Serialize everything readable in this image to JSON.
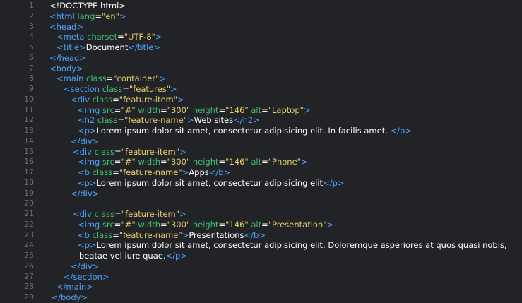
{
  "colors": {
    "background": "#212326",
    "line_number": "#6b6f75",
    "tag": "#4aa3ff",
    "attribute": "#40c070",
    "string": "#e7d06a",
    "text": "#ffffff"
  },
  "lines": [
    {
      "num": "1",
      "indent": 0,
      "tokens": [
        {
          "t": "txt",
          "v": "<!DOCTYPE html>"
        }
      ]
    },
    {
      "num": "2",
      "indent": 0,
      "tokens": [
        {
          "t": "tag",
          "v": "<html "
        },
        {
          "t": "attr",
          "v": "lang"
        },
        {
          "t": "txt",
          "v": "="
        },
        {
          "t": "str",
          "v": "\"en\""
        },
        {
          "t": "tag",
          "v": ">"
        }
      ]
    },
    {
      "num": "3",
      "indent": 0,
      "tokens": [
        {
          "t": "tag",
          "v": "<head>"
        }
      ]
    },
    {
      "num": "4",
      "indent": 1,
      "tokens": [
        {
          "t": "tag",
          "v": "<meta "
        },
        {
          "t": "attr",
          "v": "charset"
        },
        {
          "t": "txt",
          "v": "="
        },
        {
          "t": "str",
          "v": "\"UTF-8\""
        },
        {
          "t": "tag",
          "v": ">"
        }
      ]
    },
    {
      "num": "5",
      "indent": 1,
      "tokens": [
        {
          "t": "tag",
          "v": "<title>"
        },
        {
          "t": "txt",
          "v": "Document"
        },
        {
          "t": "tag",
          "v": "</title>"
        }
      ]
    },
    {
      "num": "6",
      "indent": 0,
      "tokens": [
        {
          "t": "tag",
          "v": "</head>"
        }
      ]
    },
    {
      "num": "7",
      "indent": 0,
      "tokens": [
        {
          "t": "tag",
          "v": "<body>"
        }
      ]
    },
    {
      "num": "8",
      "indent": 1,
      "tokens": [
        {
          "t": "tag",
          "v": "<main "
        },
        {
          "t": "attr",
          "v": "class"
        },
        {
          "t": "txt",
          "v": "="
        },
        {
          "t": "str",
          "v": "\"container\""
        },
        {
          "t": "tag",
          "v": ">"
        }
      ]
    },
    {
      "num": "9",
      "indent": 2,
      "tokens": [
        {
          "t": "tag",
          "v": "<section "
        },
        {
          "t": "attr",
          "v": "class"
        },
        {
          "t": "txt",
          "v": "="
        },
        {
          "t": "str",
          "v": "\"features\""
        },
        {
          "t": "tag",
          "v": ">"
        }
      ]
    },
    {
      "num": "10",
      "indent": 3,
      "tokens": [
        {
          "t": "tag",
          "v": "<div "
        },
        {
          "t": "attr",
          "v": "class"
        },
        {
          "t": "txt",
          "v": "="
        },
        {
          "t": "str",
          "v": "\"feature-item\""
        },
        {
          "t": "tag",
          "v": ">"
        }
      ]
    },
    {
      "num": "11",
      "indent": 4,
      "tokens": [
        {
          "t": "tag",
          "v": "<img "
        },
        {
          "t": "attr",
          "v": "src"
        },
        {
          "t": "txt",
          "v": "="
        },
        {
          "t": "str",
          "v": "\"#\" "
        },
        {
          "t": "attr",
          "v": "width"
        },
        {
          "t": "txt",
          "v": "="
        },
        {
          "t": "str",
          "v": "\"300\" "
        },
        {
          "t": "attr",
          "v": "height"
        },
        {
          "t": "txt",
          "v": "="
        },
        {
          "t": "str",
          "v": "\"146\" "
        },
        {
          "t": "attr",
          "v": "alt"
        },
        {
          "t": "txt",
          "v": "="
        },
        {
          "t": "str",
          "v": "\"Laptop\""
        },
        {
          "t": "tag",
          "v": ">"
        }
      ]
    },
    {
      "num": "12",
      "indent": 4,
      "tokens": [
        {
          "t": "tag",
          "v": "<h2 "
        },
        {
          "t": "attr",
          "v": "class"
        },
        {
          "t": "txt",
          "v": "="
        },
        {
          "t": "str",
          "v": "\"feature-name\""
        },
        {
          "t": "tag",
          "v": ">"
        },
        {
          "t": "txt",
          "v": "Web sites"
        },
        {
          "t": "tag",
          "v": "</h2>"
        }
      ]
    },
    {
      "num": "13",
      "indent": 4,
      "tokens": [
        {
          "t": "tag",
          "v": "<p>"
        },
        {
          "t": "txt",
          "v": "Lorem ipsum dolor sit amet, consectetur adipisicing elit. In facilis amet. "
        },
        {
          "t": "tag",
          "v": "</p>"
        }
      ]
    },
    {
      "num": "14",
      "indent": 3,
      "tokens": [
        {
          "t": "tag",
          "v": "</div>"
        }
      ]
    },
    {
      "num": "15",
      "indent": 3.3,
      "tokens": [
        {
          "t": "tag",
          "v": "<div "
        },
        {
          "t": "attr",
          "v": "class"
        },
        {
          "t": "txt",
          "v": "="
        },
        {
          "t": "str",
          "v": "\"feature-item\""
        },
        {
          "t": "tag",
          "v": ">"
        }
      ]
    },
    {
      "num": "16",
      "indent": 4,
      "tokens": [
        {
          "t": "tag",
          "v": "<img "
        },
        {
          "t": "attr",
          "v": "src"
        },
        {
          "t": "txt",
          "v": "="
        },
        {
          "t": "str",
          "v": "\"#\" "
        },
        {
          "t": "attr",
          "v": "width"
        },
        {
          "t": "txt",
          "v": "="
        },
        {
          "t": "str",
          "v": "\"300\" "
        },
        {
          "t": "attr",
          "v": "height"
        },
        {
          "t": "txt",
          "v": "="
        },
        {
          "t": "str",
          "v": "\"146\" "
        },
        {
          "t": "attr",
          "v": "alt"
        },
        {
          "t": "txt",
          "v": "="
        },
        {
          "t": "str",
          "v": "\"Phone\""
        },
        {
          "t": "tag",
          "v": ">"
        }
      ]
    },
    {
      "num": "17",
      "indent": 4,
      "tokens": [
        {
          "t": "tag",
          "v": "<b "
        },
        {
          "t": "attr",
          "v": "class"
        },
        {
          "t": "txt",
          "v": "="
        },
        {
          "t": "str",
          "v": "\"feature-name\""
        },
        {
          "t": "tag",
          "v": ">"
        },
        {
          "t": "txt",
          "v": "Apps"
        },
        {
          "t": "tag",
          "v": "</b>"
        }
      ]
    },
    {
      "num": "18",
      "indent": 4,
      "tokens": [
        {
          "t": "tag",
          "v": "<p>"
        },
        {
          "t": "txt",
          "v": "Lorem ipsum dolor sit amet, consectetur adipisicing elit"
        },
        {
          "t": "tag",
          "v": "</p>"
        }
      ]
    },
    {
      "num": "19",
      "indent": 3,
      "tokens": [
        {
          "t": "tag",
          "v": "</div>"
        }
      ]
    },
    {
      "num": "20",
      "indent": 0,
      "tokens": []
    },
    {
      "num": "21",
      "indent": 3.3,
      "tokens": [
        {
          "t": "tag",
          "v": "<div "
        },
        {
          "t": "attr",
          "v": "class"
        },
        {
          "t": "txt",
          "v": "="
        },
        {
          "t": "str",
          "v": "\"feature-item\""
        },
        {
          "t": "tag",
          "v": ">"
        }
      ]
    },
    {
      "num": "22",
      "indent": 4,
      "tokens": [
        {
          "t": "tag",
          "v": "<img "
        },
        {
          "t": "attr",
          "v": "src"
        },
        {
          "t": "txt",
          "v": "="
        },
        {
          "t": "str",
          "v": "\"#\" "
        },
        {
          "t": "attr",
          "v": "width"
        },
        {
          "t": "txt",
          "v": "="
        },
        {
          "t": "str",
          "v": "\"300\" "
        },
        {
          "t": "attr",
          "v": "height"
        },
        {
          "t": "txt",
          "v": "="
        },
        {
          "t": "str",
          "v": "\"146\" "
        },
        {
          "t": "attr",
          "v": "alt"
        },
        {
          "t": "txt",
          "v": "="
        },
        {
          "t": "str",
          "v": "\"Presentation\""
        },
        {
          "t": "tag",
          "v": ">"
        }
      ]
    },
    {
      "num": "23",
      "indent": 4,
      "tokens": [
        {
          "t": "tag",
          "v": "<b "
        },
        {
          "t": "attr",
          "v": "class"
        },
        {
          "t": "txt",
          "v": "="
        },
        {
          "t": "str",
          "v": "\"feature-name\""
        },
        {
          "t": "tag",
          "v": ">"
        },
        {
          "t": "txt",
          "v": "Presentations"
        },
        {
          "t": "tag",
          "v": "</b>"
        }
      ]
    },
    {
      "num": "24",
      "indent": 4,
      "tokens": [
        {
          "t": "tag",
          "v": "<p>"
        },
        {
          "t": "txt",
          "v": "Lorem ipsum dolor sit amet, consectetur adipisicing elit. Doloremque asperiores at quos quasi nobis,"
        }
      ]
    },
    {
      "num": "25",
      "indent": 4.2,
      "tokens": [
        {
          "t": "txt",
          "v": "beatae vel iure quae."
        },
        {
          "t": "tag",
          "v": "</p>"
        }
      ]
    },
    {
      "num": "26",
      "indent": 3,
      "tokens": [
        {
          "t": "tag",
          "v": "</div>"
        }
      ]
    },
    {
      "num": "27",
      "indent": 2,
      "tokens": [
        {
          "t": "tag",
          "v": "</section>"
        }
      ]
    },
    {
      "num": "28",
      "indent": 1,
      "tokens": [
        {
          "t": "tag",
          "v": "</main>"
        }
      ]
    },
    {
      "num": "29",
      "indent": 0.25,
      "tokens": [
        {
          "t": "tag",
          "v": "</body>"
        }
      ]
    }
  ]
}
